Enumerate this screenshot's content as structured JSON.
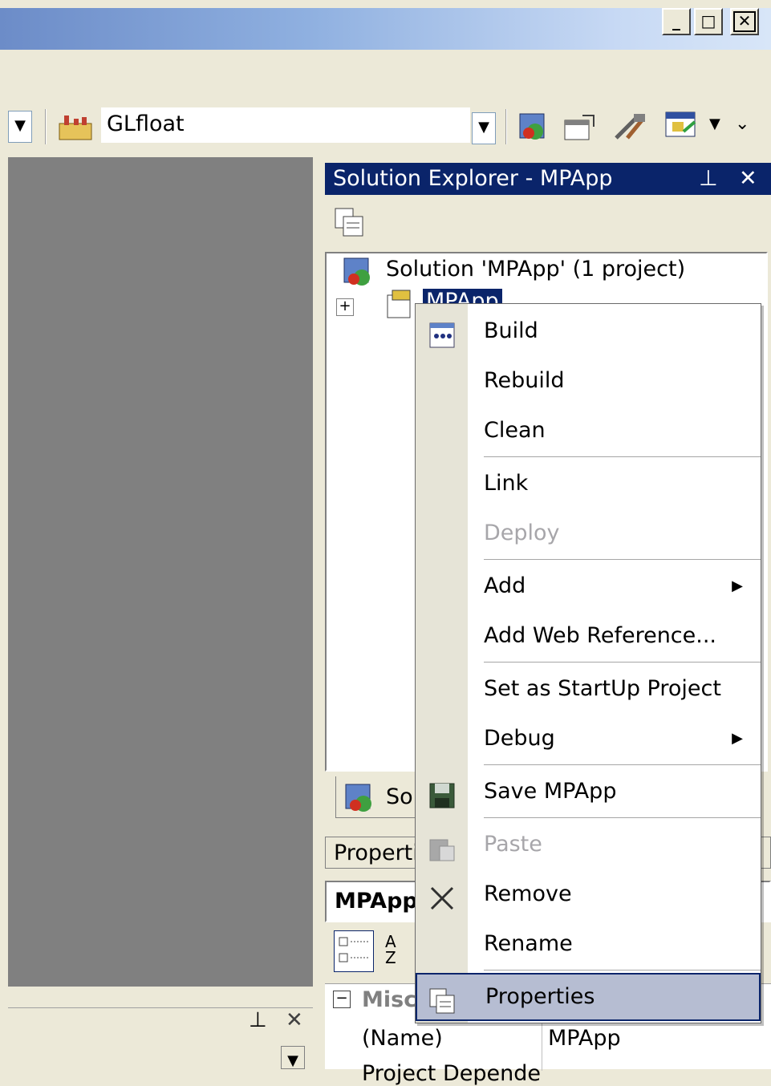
{
  "window": {
    "minimize_label": "_",
    "maximize_label": "□",
    "close_label": "✕"
  },
  "toolbar": {
    "solution_config_value": "GLfloat"
  },
  "solution_explorer": {
    "title": "Solution Explorer - MPApp",
    "solution_node": "Solution 'MPApp' (1 project)",
    "project_node": "MPApp",
    "tab_label": "Sol"
  },
  "properties": {
    "title": "Properti",
    "object": "MPApp",
    "category": "Misc",
    "rows": [
      {
        "name": "(Name)",
        "value": "MPApp"
      },
      {
        "name": "Project Depende",
        "value": ""
      }
    ]
  },
  "context_menu": {
    "items": [
      {
        "label": "Build",
        "icon": "build-icon",
        "disabled": false
      },
      {
        "label": "Rebuild",
        "icon": "",
        "disabled": false
      },
      {
        "label": "Clean",
        "icon": "",
        "disabled": false
      },
      {
        "label": "Link",
        "icon": "",
        "disabled": false
      },
      {
        "label": "Deploy",
        "icon": "",
        "disabled": true
      },
      {
        "label": "Add",
        "icon": "",
        "disabled": false,
        "submenu": true
      },
      {
        "label": "Add Web Reference...",
        "icon": "",
        "disabled": false
      },
      {
        "label": "Set as StartUp Project",
        "icon": "",
        "disabled": false
      },
      {
        "label": "Debug",
        "icon": "",
        "disabled": false,
        "submenu": true
      },
      {
        "label": "Save MPApp",
        "icon": "save-icon",
        "disabled": false
      },
      {
        "label": "Paste",
        "icon": "paste-icon",
        "disabled": true
      },
      {
        "label": "Remove",
        "icon": "remove-icon",
        "disabled": false
      },
      {
        "label": "Rename",
        "icon": "",
        "disabled": false
      },
      {
        "label": "Properties",
        "icon": "properties-icon",
        "disabled": false,
        "highlighted": true
      }
    ]
  }
}
